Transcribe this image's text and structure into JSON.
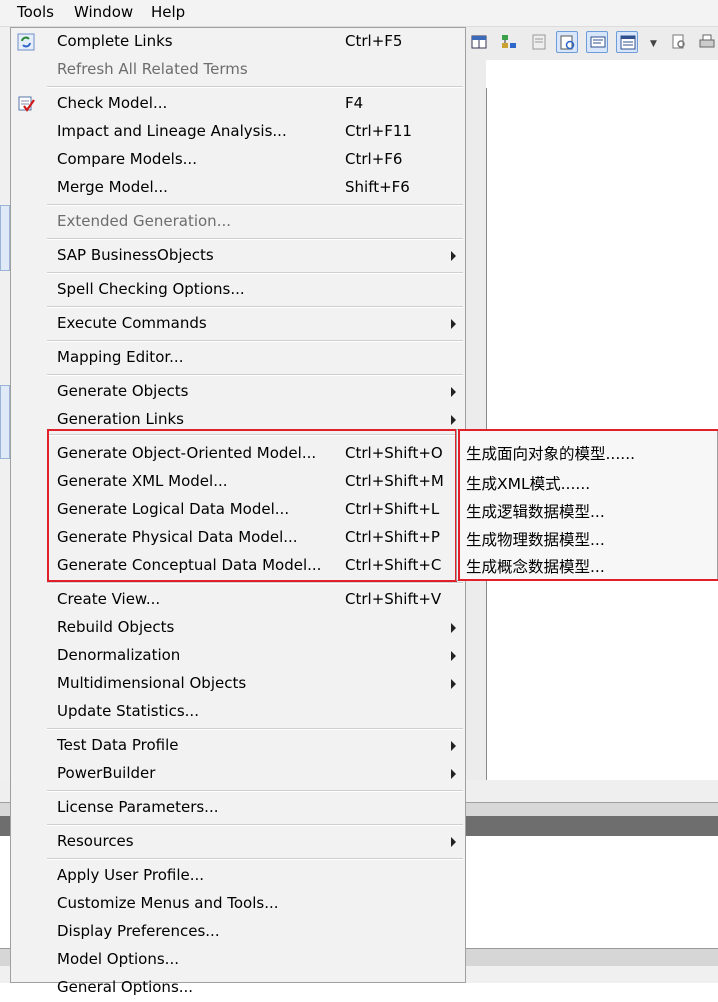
{
  "menubar": {
    "items": [
      "Tools",
      "Window",
      "Help"
    ]
  },
  "menu": {
    "items": [
      {
        "label": "Complete Links",
        "accel": "Ctrl+F5",
        "icon": "refresh-links-icon"
      },
      {
        "label": "Refresh All Related Terms",
        "accel": "",
        "disabled": true
      },
      {
        "label": "Check Model...",
        "accel": "F4",
        "icon": "check-model-icon"
      },
      {
        "label": "Impact and Lineage Analysis...",
        "accel": "Ctrl+F11"
      },
      {
        "label": "Compare Models...",
        "accel": "Ctrl+F6"
      },
      {
        "label": "Merge Model...",
        "accel": "Shift+F6"
      },
      {
        "label": "Extended Generation...",
        "accel": "",
        "disabled": true
      },
      {
        "label": "SAP BusinessObjects",
        "submenu": true
      },
      {
        "label": "Spell Checking Options...",
        "accel": ""
      },
      {
        "label": "Execute Commands",
        "submenu": true
      },
      {
        "label": "Mapping Editor...",
        "accel": ""
      },
      {
        "label": "Generate Objects",
        "submenu": true
      },
      {
        "label": "Generation Links",
        "submenu": true
      },
      {
        "label": "Generate Object-Oriented Model...",
        "accel": "Ctrl+Shift+O"
      },
      {
        "label": "Generate XML Model...",
        "accel": "Ctrl+Shift+M"
      },
      {
        "label": "Generate Logical Data Model...",
        "accel": "Ctrl+Shift+L"
      },
      {
        "label": "Generate Physical Data Model...",
        "accel": "Ctrl+Shift+P"
      },
      {
        "label": "Generate Conceptual Data Model...",
        "accel": "Ctrl+Shift+C"
      },
      {
        "label": "Create View...",
        "accel": "Ctrl+Shift+V"
      },
      {
        "label": "Rebuild Objects",
        "submenu": true
      },
      {
        "label": "Denormalization",
        "submenu": true
      },
      {
        "label": "Multidimensional Objects",
        "submenu": true
      },
      {
        "label": "Update Statistics...",
        "accel": ""
      },
      {
        "label": "Test Data Profile",
        "submenu": true
      },
      {
        "label": "PowerBuilder",
        "submenu": true
      },
      {
        "label": "License Parameters...",
        "accel": ""
      },
      {
        "label": "Resources",
        "submenu": true
      },
      {
        "label": "Apply User Profile...",
        "accel": ""
      },
      {
        "label": "Customize Menus and Tools...",
        "accel": ""
      },
      {
        "label": "Display Preferences...",
        "accel": ""
      },
      {
        "label": "Model Options...",
        "accel": ""
      },
      {
        "label": "General Options...",
        "accel": ""
      }
    ]
  },
  "submenu": {
    "items": [
      "生成面向对象的模型......",
      "生成XML模式......",
      "生成逻辑数据模型...",
      "生成物理数据模型...",
      "生成概念数据模型..."
    ]
  },
  "colors": {
    "highlight_border": "#e0202a",
    "menu_bg": "#f2f2f2"
  }
}
